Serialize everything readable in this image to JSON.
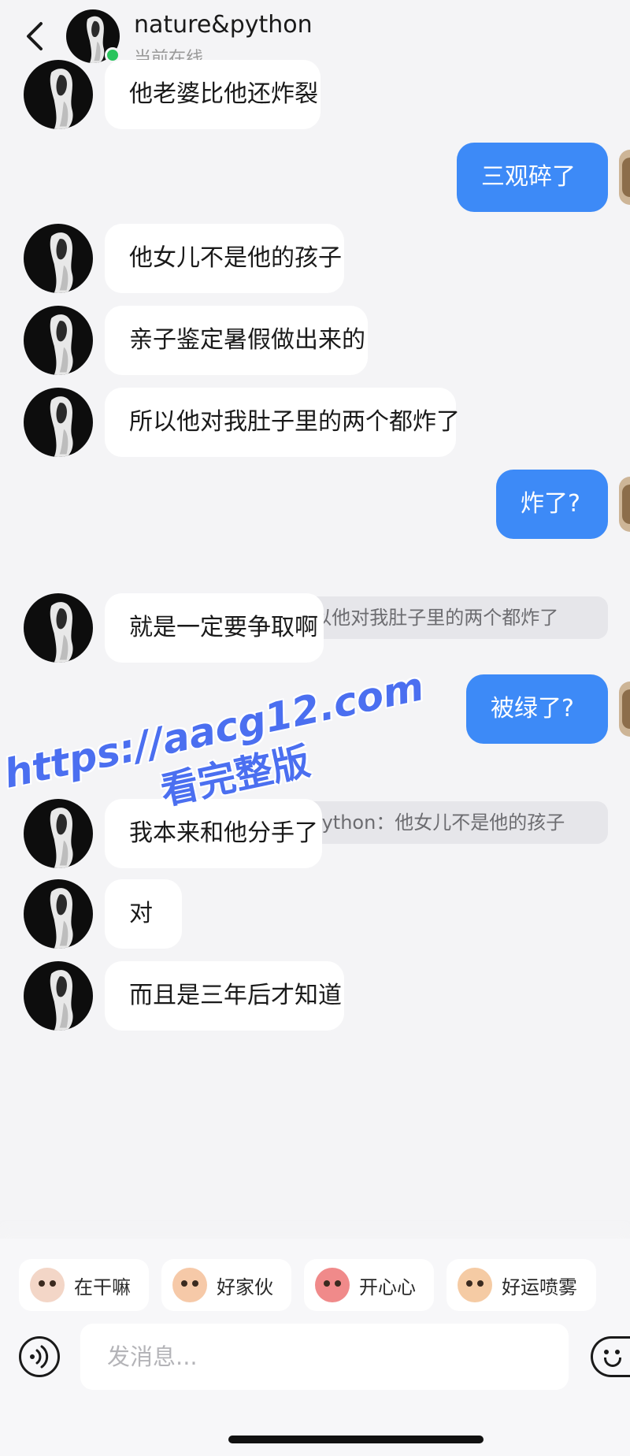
{
  "header": {
    "name": "nature&python",
    "status": "当前在线"
  },
  "messages": [
    {
      "side": "in",
      "text": "他老婆比他还炸裂"
    },
    {
      "side": "out",
      "text": "三观碎了"
    },
    {
      "side": "in",
      "text": "他女儿不是他的孩子"
    },
    {
      "side": "in",
      "text": "亲子鉴定暑假做出来的"
    },
    {
      "side": "in",
      "text": "所以他对我肚子里的两个都炸了"
    },
    {
      "side": "out",
      "text": "炸了?",
      "quote": "nature&python：所以他对我肚子里的两个都炸了"
    },
    {
      "side": "in",
      "text": "就是一定要争取啊"
    },
    {
      "side": "out",
      "text": "被绿了?",
      "quote": "nature&python：他女儿不是他的孩子"
    },
    {
      "side": "in",
      "text": "我本来和他分手了"
    },
    {
      "side": "in",
      "text": "对"
    },
    {
      "side": "in",
      "text": "而且是三年后才知道"
    }
  ],
  "watermark": {
    "url": "https://aacg12.com",
    "text": "看完整版"
  },
  "stickers": [
    {
      "label": "在干嘛",
      "icon": "sticker-zaiganma-icon",
      "color": "#f3d6c7"
    },
    {
      "label": "好家伙",
      "icon": "sticker-haojiahuo-icon",
      "color": "#f6c9a8"
    },
    {
      "label": "开心心",
      "icon": "sticker-kaixinxin-icon",
      "color": "#f08a8a"
    },
    {
      "label": "好运喷雾",
      "icon": "sticker-haoyunpenwu-icon",
      "color": "#f5cba4"
    }
  ],
  "composer": {
    "placeholder": "发消息..."
  },
  "colors": {
    "outgoing_bubble": "#3d8af7",
    "incoming_bubble": "#ffffff",
    "online_dot": "#29c45c",
    "watermark": "#4b6ff0"
  }
}
